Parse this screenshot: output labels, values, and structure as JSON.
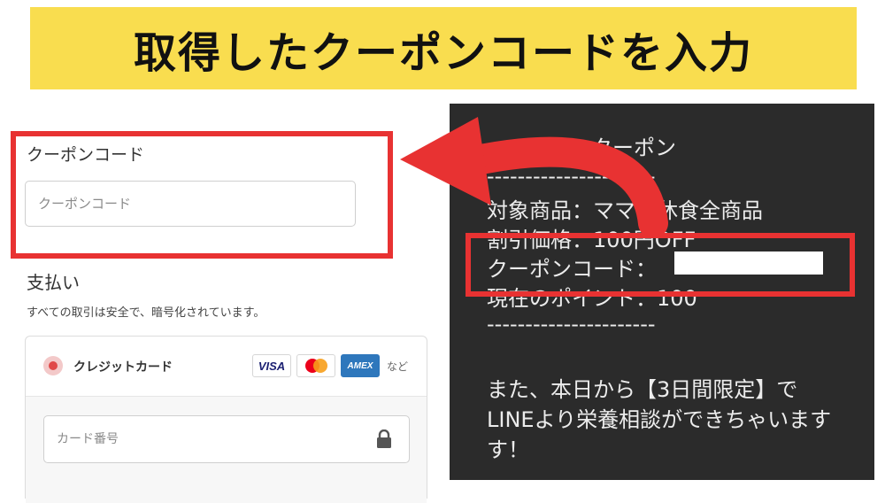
{
  "banner": {
    "title": "取得したクーポンコードを入力"
  },
  "checkout": {
    "coupon_label": "クーポンコード",
    "coupon_placeholder": "クーポンコード",
    "payment_heading": "支払い",
    "payment_desc": "すべての取引は安全で、暗号化されています。",
    "card_option_label": "クレジットカード",
    "card_brands": [
      "VISA",
      "mastercard-icon",
      "AMEX"
    ],
    "card_brands_more": "など",
    "card_number_placeholder": "カード番号"
  },
  "message": {
    "lines": [
      "クーポン",
      "----------------------",
      "対象商品：ママの休食全商品",
      "割引価格：100円OFF",
      "クーポンコード：",
      "現在のポイント：100",
      "----------------------",
      "また、本日から【3日間限定】で",
      "LINEより栄養相談ができちゃいます",
      "す！"
    ]
  },
  "colors": {
    "banner_bg": "#f9dd4f",
    "highlight_red": "#e83232",
    "message_bg": "#2b2b2b"
  }
}
